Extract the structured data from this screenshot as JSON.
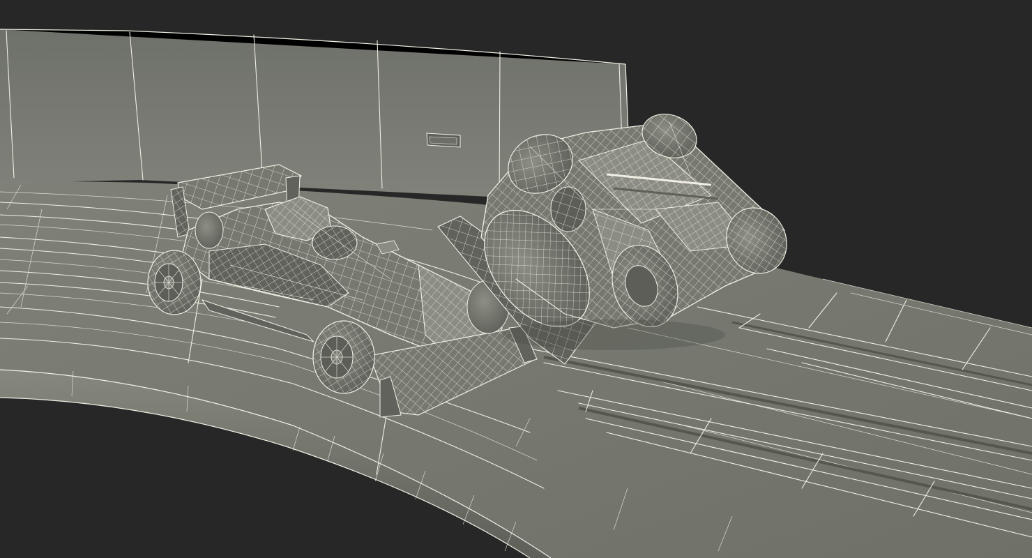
{
  "scene": {
    "background": "#272727",
    "surface_color": "#7a7c73",
    "wire_color": "#f1efe4"
  },
  "objects": [
    {
      "kind": "barrier-wall"
    },
    {
      "kind": "slot-car-track"
    },
    {
      "kind": "formula-race-car"
    },
    {
      "kind": "crashed-race-car"
    }
  ]
}
